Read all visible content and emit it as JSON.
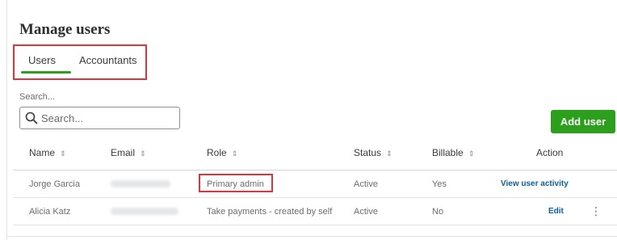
{
  "page": {
    "title": "Manage users"
  },
  "tabs": [
    {
      "label": "Users",
      "active": true
    },
    {
      "label": "Accountants",
      "active": false
    }
  ],
  "search": {
    "label": "Search...",
    "placeholder": "Search...",
    "value": ""
  },
  "actions": {
    "add_user_label": "Add user"
  },
  "table": {
    "columns": [
      {
        "label": "Name",
        "sortable": true
      },
      {
        "label": "Email",
        "sortable": true
      },
      {
        "label": "Role",
        "sortable": true
      },
      {
        "label": "Status",
        "sortable": true
      },
      {
        "label": "Billable",
        "sortable": true
      },
      {
        "label": "Action",
        "sortable": false
      }
    ],
    "rows": [
      {
        "name": "Jorge Garcia",
        "email": "",
        "role": "Primary admin",
        "status": "Active",
        "billable": "Yes",
        "action": "View user activity",
        "has_menu": false
      },
      {
        "name": "Alicia Katz",
        "email": "",
        "role": "Take payments - created by self",
        "status": "Active",
        "billable": "No",
        "action": "Edit",
        "has_menu": true
      }
    ]
  },
  "colors": {
    "accent": "#2ca01c",
    "highlight": "#d9363e",
    "link": "#0d5fa6"
  },
  "icons": {
    "search": "search-icon",
    "sort": "sort-icon",
    "more": "more-vertical-icon"
  }
}
